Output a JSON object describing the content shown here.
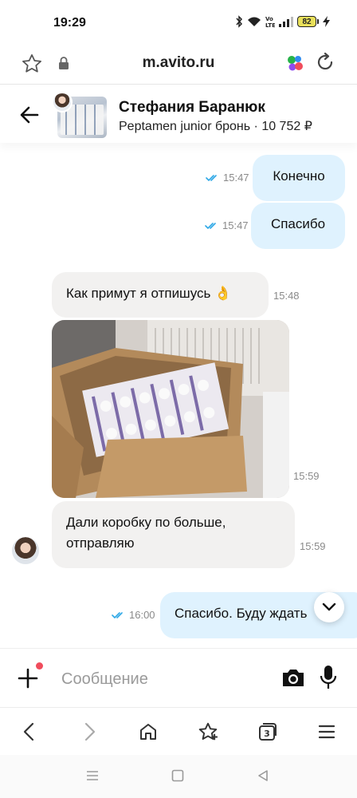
{
  "status_bar": {
    "time": "19:29",
    "battery": "82"
  },
  "browser": {
    "url": "m.avito.ru",
    "icons": [
      "star-icon",
      "lock-icon",
      "browser-app-icon",
      "reload-icon"
    ]
  },
  "chat_header": {
    "name": "Стефания Баранюк",
    "listing": "Peptamen junior бронь · 10 752 ₽"
  },
  "messages": [
    {
      "direction": "out",
      "text": "Конечно",
      "time": "15:47",
      "read": true
    },
    {
      "direction": "out",
      "text": "Спасибо",
      "time": "15:47",
      "read": true
    },
    {
      "direction": "in",
      "text": "Как примут я отпишусь 👌",
      "time": "15:48"
    },
    {
      "direction": "in",
      "type": "photo",
      "time": "15:59"
    },
    {
      "direction": "in",
      "text_line1": "Дали коробку по больше,",
      "text_line2": "отправляю",
      "time": "15:59"
    },
    {
      "direction": "out",
      "text": "Спасибо. Буду ждать",
      "time": "16:00",
      "read": true
    }
  ],
  "composer": {
    "placeholder": "Сообщение"
  },
  "colors": {
    "outgoing_bubble": "#dff2fe",
    "incoming_bubble": "#f2f1f0",
    "read_check": "#2ea8e6",
    "notification_dot": "#f04c5c"
  }
}
